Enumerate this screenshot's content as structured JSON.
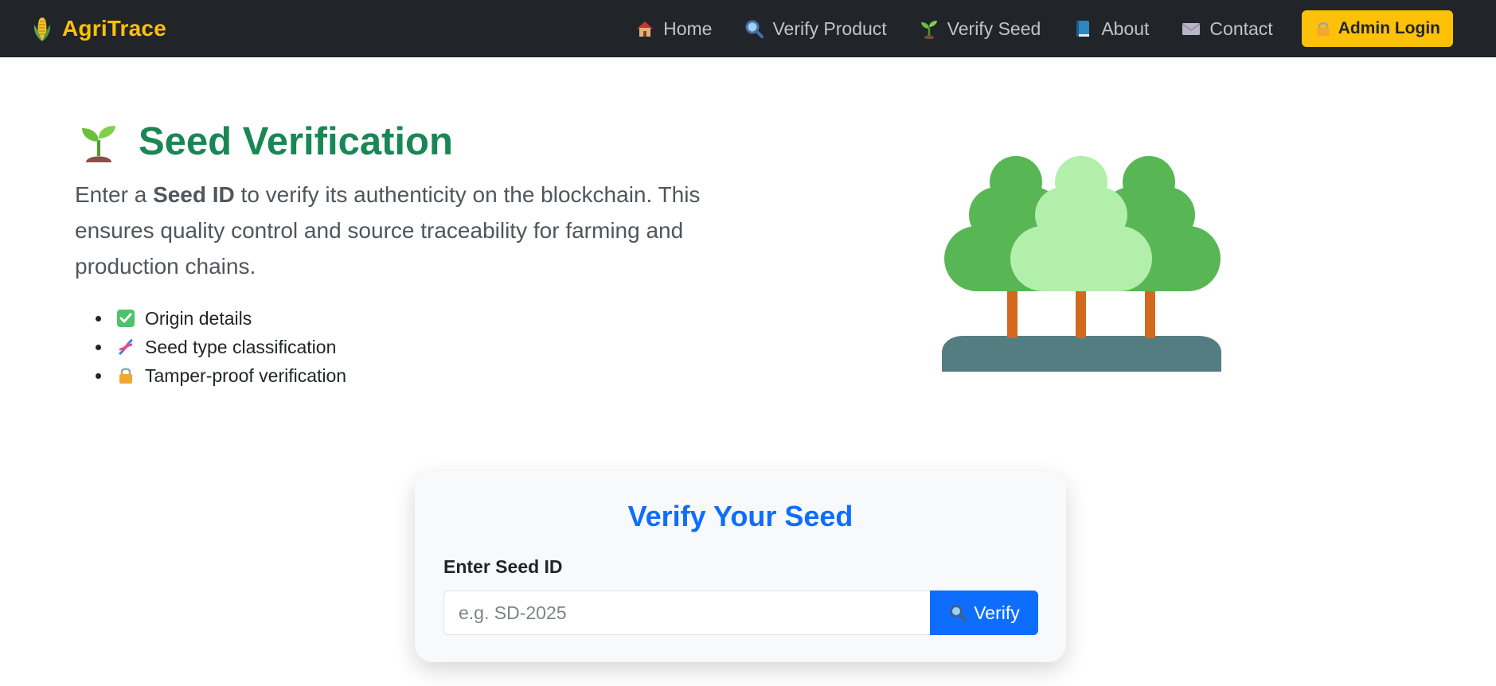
{
  "navbar": {
    "brand": "AgriTrace",
    "brand_icon": "corn-icon",
    "links": [
      {
        "label": "Home",
        "icon": "house-icon"
      },
      {
        "label": "Verify Product",
        "icon": "magnifier-icon"
      },
      {
        "label": "Verify Seed",
        "icon": "seedling-icon"
      },
      {
        "label": "About",
        "icon": "book-icon"
      },
      {
        "label": "Contact",
        "icon": "envelope-icon"
      }
    ],
    "admin_login": {
      "label": "Admin Login",
      "icon": "lock-icon"
    }
  },
  "hero": {
    "title": "Seed Verification",
    "title_icon": "seedling-icon",
    "desc_prefix": "Enter a ",
    "desc_bold": "Seed ID",
    "desc_suffix": " to verify its authenticity on the blockchain. This ensures quality control and source traceability for farming and production chains.",
    "features": [
      {
        "label": "Origin details",
        "icon": "check-box-icon"
      },
      {
        "label": "Seed type classification",
        "icon": "dna-icon"
      },
      {
        "label": "Tamper-proof verification",
        "icon": "lock-icon"
      }
    ],
    "illustration": "trees-icon"
  },
  "verify_card": {
    "title": "Verify Your Seed",
    "input_label": "Enter Seed ID",
    "input_placeholder": "e.g. SD-2025",
    "input_value": "",
    "button_label": "Verify",
    "button_icon": "magnifier-icon"
  },
  "colors": {
    "navbar_bg": "#212529",
    "brand": "#ffc107",
    "title_green": "#198754",
    "card_title_blue": "#0d6efd",
    "button_blue": "#0d6efd"
  }
}
